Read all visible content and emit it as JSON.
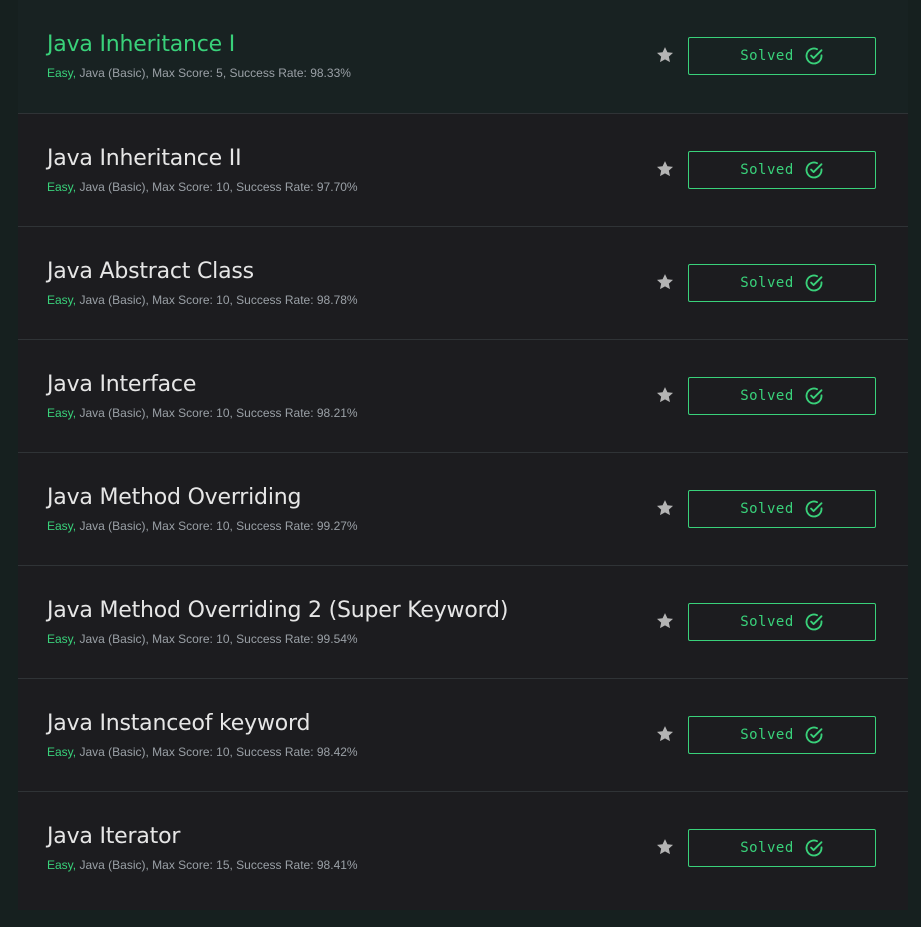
{
  "challenges": [
    {
      "title": "Java Inheritance I",
      "difficulty": "Easy,",
      "details": " Java (Basic), Max Score: 5, Success Rate: 98.33%",
      "status": "Solved"
    },
    {
      "title": "Java Inheritance II",
      "difficulty": "Easy,",
      "details": " Java (Basic), Max Score: 10, Success Rate: 97.70%",
      "status": "Solved"
    },
    {
      "title": "Java Abstract Class",
      "difficulty": "Easy,",
      "details": " Java (Basic), Max Score: 10, Success Rate: 98.78%",
      "status": "Solved"
    },
    {
      "title": "Java Interface",
      "difficulty": "Easy,",
      "details": " Java (Basic), Max Score: 10, Success Rate: 98.21%",
      "status": "Solved"
    },
    {
      "title": "Java Method Overriding",
      "difficulty": "Easy,",
      "details": " Java (Basic), Max Score: 10, Success Rate: 99.27%",
      "status": "Solved"
    },
    {
      "title": "Java Method Overriding 2 (Super Keyword)",
      "difficulty": "Easy,",
      "details": " Java (Basic), Max Score: 10, Success Rate: 99.54%",
      "status": "Solved"
    },
    {
      "title": "Java Instanceof keyword",
      "difficulty": "Easy,",
      "details": " Java (Basic), Max Score: 10, Success Rate: 98.42%",
      "status": "Solved"
    },
    {
      "title": "Java Iterator",
      "difficulty": "Easy,",
      "details": " Java (Basic), Max Score: 15, Success Rate: 98.41%",
      "status": "Solved"
    }
  ],
  "icons": {
    "bookmark": "star-icon",
    "status": "check-circle-icon"
  },
  "colors": {
    "accent": "#39d17a",
    "row_bg": "#1c1c1f",
    "highlight_bg": "#182222",
    "text": "#e6e6e6",
    "muted": "#9aa0a6",
    "star": "#b4b4b4"
  }
}
